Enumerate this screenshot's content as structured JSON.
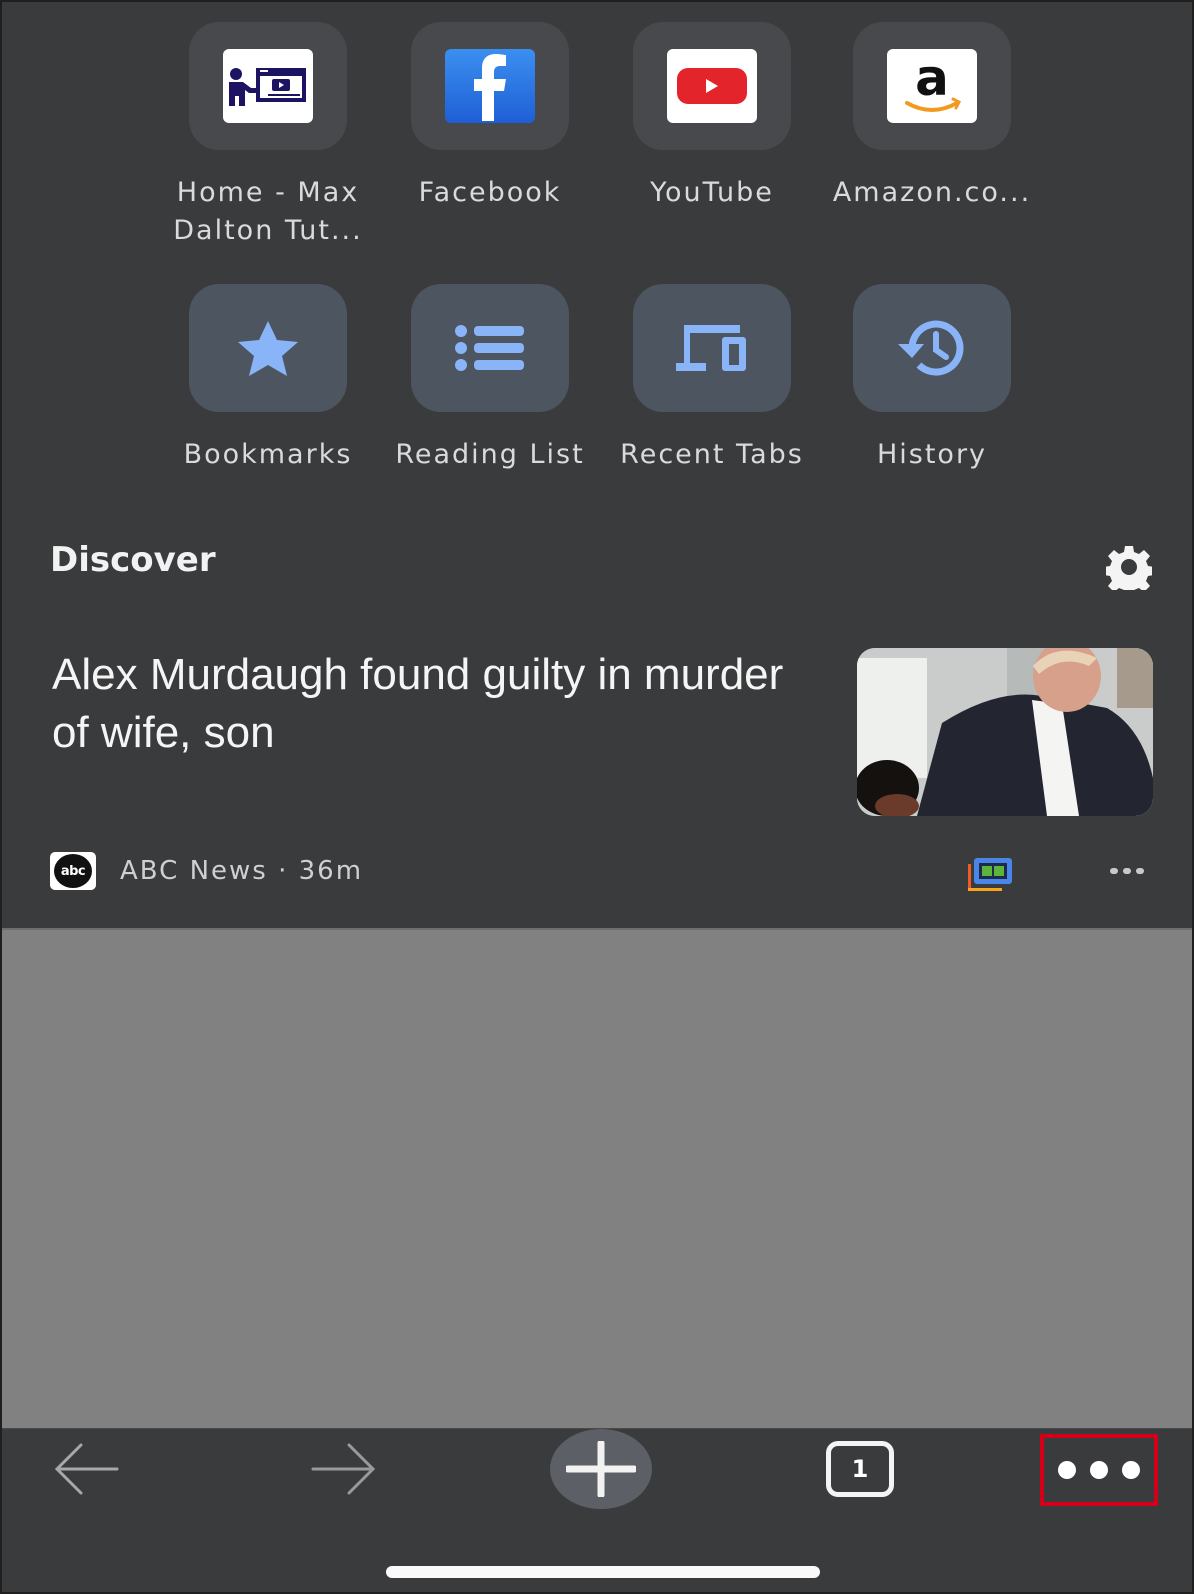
{
  "shortcuts": [
    {
      "label_line1": "Home - Max",
      "label_line2": "Dalton Tut...",
      "icon": "max-dalton-tutorials-favicon"
    },
    {
      "label_line1": "Facebook",
      "label_line2": "",
      "icon": "facebook-favicon"
    },
    {
      "label_line1": "YouTube",
      "label_line2": "",
      "icon": "youtube-favicon"
    },
    {
      "label_line1": "Amazon.co...",
      "label_line2": "",
      "icon": "amazon-favicon"
    }
  ],
  "actions": [
    {
      "label": "Bookmarks",
      "icon": "star-icon"
    },
    {
      "label": "Reading List",
      "icon": "list-icon"
    },
    {
      "label": "Recent Tabs",
      "icon": "devices-icon"
    },
    {
      "label": "History",
      "icon": "history-icon"
    }
  ],
  "discover": {
    "title": "Discover",
    "settings_icon": "gear-icon",
    "article": {
      "headline": "Alex Murdaugh found guilty in murder of wife, son",
      "source": "ABC News",
      "age": "36m",
      "source_line": "ABC News · 36m",
      "logo_text": "abc"
    }
  },
  "toolbar": {
    "back_icon": "arrow-left-icon",
    "forward_icon": "arrow-right-icon",
    "new_tab_icon": "plus-icon",
    "tab_count": "1",
    "menu_icon": "more-horizontal-icon",
    "highlight_color": "#d4001a"
  },
  "colors": {
    "background": "#3a3b3d",
    "tile": "#47494c",
    "action_tile": "#4d5560",
    "accent_blue": "#8ab4f8",
    "scrim": "#818181"
  }
}
